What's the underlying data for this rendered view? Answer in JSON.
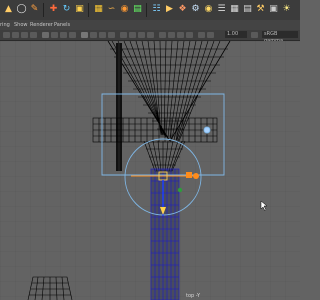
{
  "menubar": {
    "items": [
      "ring",
      "Show",
      "Renderer",
      "Panels"
    ]
  },
  "toolbar": {
    "icons": [
      "select-tool",
      "lasso-tool",
      "paint-select",
      "move-tool",
      "rotate-tool",
      "scale-tool",
      "snap-grid",
      "snap-curve",
      "snap-point",
      "snap-view",
      "history",
      "render",
      "ipr-render",
      "render-settings",
      "hypershade",
      "outliner",
      "attribute-editor",
      "channel-box",
      "tool-settings",
      "camera-icon",
      "light-icon",
      "grid-toggle",
      "display-toggle"
    ]
  },
  "panel": {
    "field_value": "1.00",
    "color_space": "sRGB gamma"
  },
  "viewport": {
    "camera_label": "top -Y",
    "wire_color": "#000000",
    "selected_color": "#1a1acc",
    "manipulator_color": "#7fb7e6",
    "pivot_color": "#ff8c1a"
  },
  "colors": {
    "toolbar_bg": "#3c3c3c",
    "viewport_bg": "#636363"
  }
}
